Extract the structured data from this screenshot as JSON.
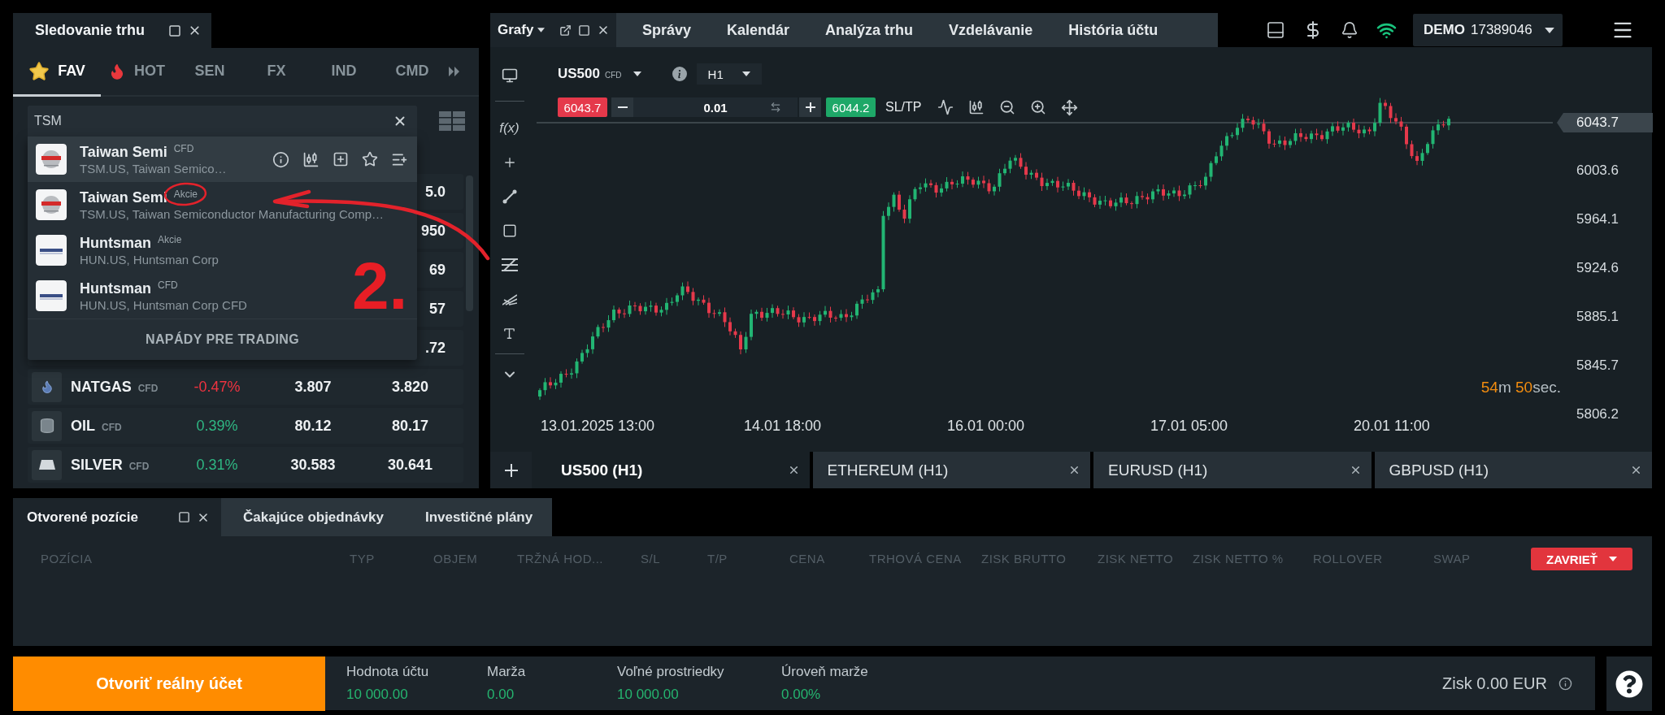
{
  "market_watch": {
    "title": "Sledovanie trhu",
    "categories": [
      {
        "label": "FAV",
        "kind": "star",
        "selected": true
      },
      {
        "label": "HOT",
        "kind": "flame",
        "selected": false
      },
      {
        "label": "SEN",
        "kind": "plain",
        "selected": false
      },
      {
        "label": "FX",
        "kind": "plain",
        "selected": false
      },
      {
        "label": "IND",
        "kind": "plain",
        "selected": false
      },
      {
        "label": "CMD",
        "kind": "plain",
        "selected": false
      }
    ],
    "search": {
      "value": "TSM"
    },
    "results": [
      {
        "name": "Taiwan Semi",
        "type": "CFD",
        "description": "TSM.US, Taiwan Semico…",
        "kind": "emblem",
        "selected": true
      },
      {
        "name": "Taiwan Semi",
        "type": "Akcie",
        "description": "TSM.US, Taiwan Semiconductor Manufacturing Comp…",
        "kind": "emblem",
        "selected": false
      },
      {
        "name": "Huntsman",
        "type": "Akcie",
        "description": "HUN.US, Huntsman Corp",
        "kind": "wordmark",
        "selected": false
      },
      {
        "name": "Huntsman",
        "type": "CFD",
        "description": "HUN.US, Huntsman Corp CFD",
        "kind": "wordmark",
        "selected": false
      }
    ],
    "results_footer": "NAPÁDY PRE TRADING",
    "covered_rows": [
      {
        "ask": "5.0"
      },
      {
        "ask": "950"
      },
      {
        "ask": "69"
      },
      {
        "ask": "57"
      },
      {
        "ask": ".72"
      }
    ],
    "rows": [
      {
        "symbol": "NATGAS",
        "type": "CFD",
        "kind": "flame",
        "change": "-0.47%",
        "negative": true,
        "bid": "3.807",
        "ask": "3.820"
      },
      {
        "symbol": "OIL",
        "type": "CFD",
        "kind": "barrel",
        "change": "0.39%",
        "negative": false,
        "bid": "80.12",
        "ask": "80.17"
      },
      {
        "symbol": "SILVER",
        "type": "CFD",
        "kind": "ingot",
        "change": "0.31%",
        "negative": false,
        "bid": "30.583",
        "ask": "30.641"
      }
    ]
  },
  "header": {
    "tabs": [
      {
        "label": "Grafy",
        "selected": true
      },
      {
        "label": "Správy",
        "selected": false
      },
      {
        "label": "Kalendár",
        "selected": false
      },
      {
        "label": "Analýza trhu",
        "selected": false
      },
      {
        "label": "Vzdelávanie",
        "selected": false
      },
      {
        "label": "História účtu",
        "selected": false
      }
    ],
    "account": {
      "mode": "DEMO",
      "number": "17389046"
    }
  },
  "chart": {
    "symbol": "US500",
    "symbol_type": "CFD",
    "timeframe": "H1",
    "sell_price": "6043.7",
    "volume": "0.01",
    "buy_price": "6044.2",
    "sl_tp": "SL/TP",
    "function_tool": "f(x)",
    "current_price": "6043.7",
    "price_ticks": [
      "6003.6",
      "5964.1",
      "5924.6",
      "5885.1",
      "5845.7",
      "5806.2"
    ],
    "time_ticks": [
      "13.01.2025 13:00",
      "14.01 18:00",
      "16.01 00:00",
      "17.01 05:00",
      "20.01 11:00"
    ],
    "countdown": {
      "minutes": "54",
      "minutes_unit": "m",
      "seconds": "50",
      "seconds_unit": "sec."
    }
  },
  "chart_tabs": [
    {
      "label": "US500 (H1)",
      "selected": true
    },
    {
      "label": "ETHEREUM (H1)",
      "selected": false
    },
    {
      "label": "EURUSD (H1)",
      "selected": false
    },
    {
      "label": "GBPUSD (H1)",
      "selected": false
    }
  ],
  "positions": {
    "tabs": [
      {
        "label": "Otvorené pozície",
        "selected": true
      },
      {
        "label": "Čakajúce objednávky",
        "selected": false
      },
      {
        "label": "Investičné plány",
        "selected": false
      }
    ],
    "columns": [
      "POZÍCIA",
      "TYP",
      "OBJEM",
      "TRŽNÁ HOD...",
      "S/L",
      "T/P",
      "CENA",
      "TRHOVÁ CENA",
      "ZISK BRUTTO",
      "ZISK NETTO",
      "ZISK NETTO %",
      "ROLLOVER",
      "SWAP"
    ],
    "close_button": "ZAVRIEŤ"
  },
  "footer": {
    "open_account": "Otvoriť reálny účet",
    "stats": [
      {
        "label": "Hodnota účtu",
        "value": "10 000.00"
      },
      {
        "label": "Marža",
        "value": "0.00"
      },
      {
        "label": "Voľné prostriedky",
        "value": "10 000.00"
      },
      {
        "label": "Úroveň marže",
        "value": "0.00%"
      }
    ],
    "profit": "Zisk 0.00 EUR"
  },
  "annotation": {
    "label": "2."
  }
}
